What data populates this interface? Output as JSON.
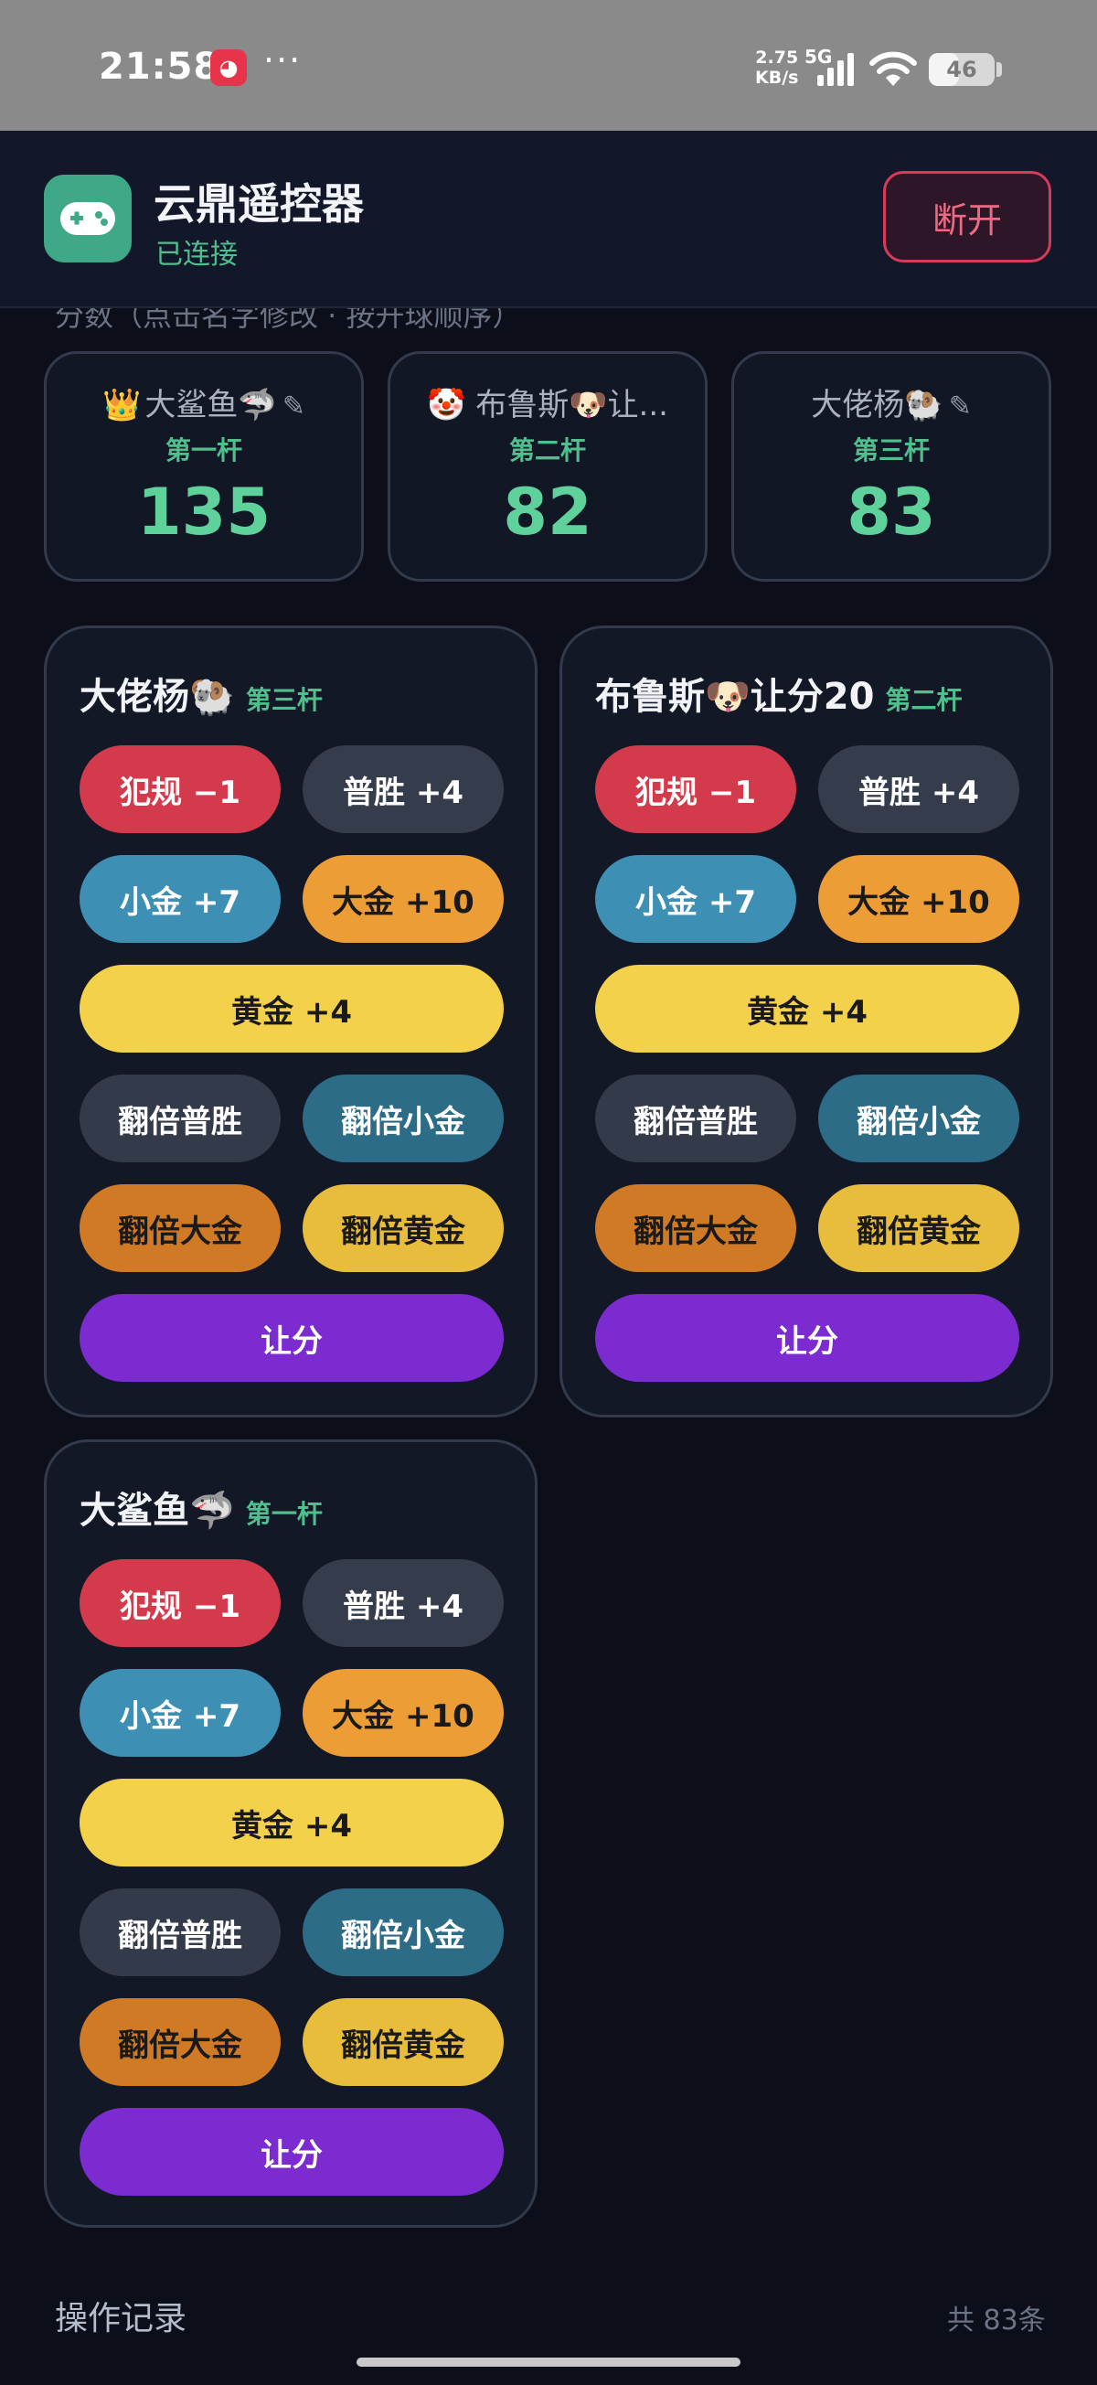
{
  "status_bar": {
    "time": "21:58",
    "net_speed_value": "2.75",
    "net_speed_unit": "KB/s",
    "network": "5G",
    "battery": "46",
    "battery_percent": 46
  },
  "header": {
    "title": "云鼎遥控器",
    "status": "已连接",
    "disconnect_label": "断开",
    "accent_color": "#3fa987"
  },
  "scores": {
    "caption": "分数（点击名字修改 · 按开球顺序）",
    "cards": [
      {
        "leader_icon": "👑",
        "name": "大鲨鱼🦈",
        "order": "第一杆",
        "score": "135"
      },
      {
        "name": "🤡 布鲁斯🐶让...",
        "order": "第二杆",
        "score": "82"
      },
      {
        "name": "大佬杨🐏",
        "order": "第三杆",
        "score": "83"
      }
    ]
  },
  "players": [
    {
      "name": "大佬杨🐏",
      "order": "第三杆",
      "buttons": {
        "foul": "犯规 −1",
        "win": "普胜 +4",
        "small_gold": "小金 +7",
        "big_gold": "大金 +10",
        "golden": "黄金 +4",
        "double_win": "翻倍普胜",
        "double_small": "翻倍小金",
        "double_big": "翻倍大金",
        "double_gold": "翻倍黄金",
        "handicap": "让分"
      }
    },
    {
      "name": "布鲁斯🐶让分20",
      "order": "第二杆",
      "buttons": {
        "foul": "犯规 −1",
        "win": "普胜 +4",
        "small_gold": "小金 +7",
        "big_gold": "大金 +10",
        "golden": "黄金 +4",
        "double_win": "翻倍普胜",
        "double_small": "翻倍小金",
        "double_big": "翻倍大金",
        "double_gold": "翻倍黄金",
        "handicap": "让分"
      }
    },
    {
      "name": "大鲨鱼🦈",
      "order": "第一杆",
      "buttons": {
        "foul": "犯规 −1",
        "win": "普胜 +4",
        "small_gold": "小金 +7",
        "big_gold": "大金 +10",
        "golden": "黄金 +4",
        "double_win": "翻倍普胜",
        "double_small": "翻倍小金",
        "double_big": "翻倍大金",
        "double_gold": "翻倍黄金",
        "handicap": "让分"
      }
    }
  ],
  "log": {
    "title": "操作记录",
    "count": "共 83条"
  }
}
